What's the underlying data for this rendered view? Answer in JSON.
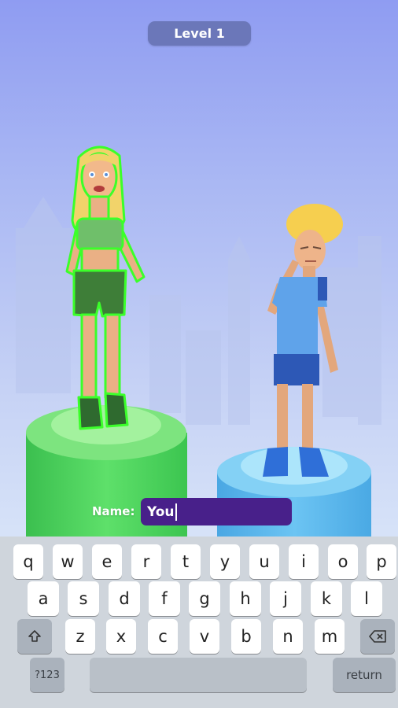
{
  "hud": {
    "level_label": "Level 1"
  },
  "name_entry": {
    "label": "Name:",
    "value": "You"
  },
  "keyboard": {
    "row1": [
      "q",
      "w",
      "e",
      "r",
      "t",
      "y",
      "u",
      "i",
      "o",
      "p"
    ],
    "row2": [
      "a",
      "s",
      "d",
      "f",
      "g",
      "h",
      "j",
      "k",
      "l"
    ],
    "row3": [
      "z",
      "x",
      "c",
      "v",
      "b",
      "n",
      "m"
    ],
    "numbers_key": "?123",
    "space_key": "",
    "return_key": "return"
  },
  "icons": {
    "shift": "shift-icon",
    "backspace": "backspace-icon"
  }
}
